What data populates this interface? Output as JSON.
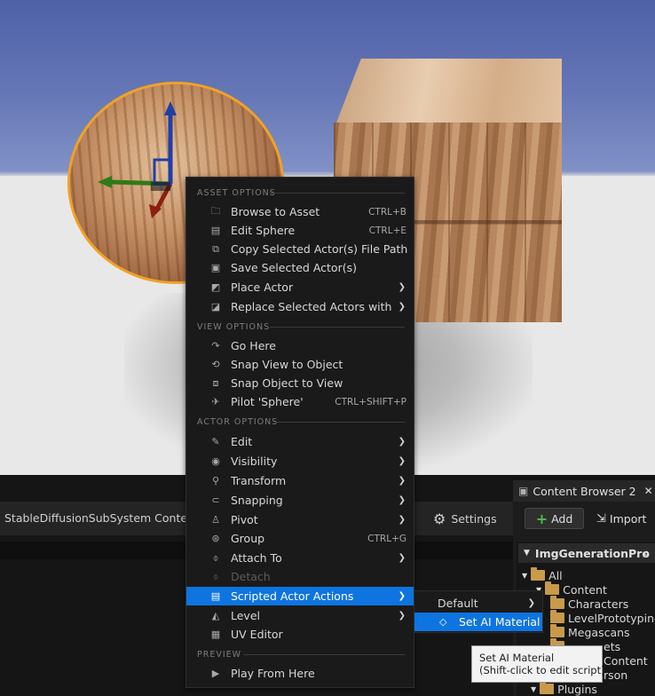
{
  "menu": {
    "sections": {
      "asset_options": "ASSET OPTIONS",
      "view_options": "VIEW OPTIONS",
      "actor_options": "ACTOR OPTIONS",
      "preview": "PREVIEW"
    },
    "items": {
      "browse_to_asset": {
        "label": "Browse to Asset",
        "shortcut": "CTRL+B"
      },
      "edit_sphere": {
        "label": "Edit Sphere",
        "shortcut": "CTRL+E"
      },
      "copy_path": {
        "label": "Copy Selected Actor(s) File Path"
      },
      "save_actors": {
        "label": "Save Selected Actor(s)"
      },
      "place_actor": {
        "label": "Place Actor"
      },
      "replace_actors": {
        "label": "Replace Selected Actors with"
      },
      "go_here": {
        "label": "Go Here"
      },
      "snap_view": {
        "label": "Snap View to Object"
      },
      "snap_object": {
        "label": "Snap Object to View"
      },
      "pilot": {
        "label": "Pilot 'Sphere'",
        "shortcut": "CTRL+SHIFT+P"
      },
      "edit": {
        "label": "Edit"
      },
      "visibility": {
        "label": "Visibility"
      },
      "transform": {
        "label": "Transform"
      },
      "snapping": {
        "label": "Snapping"
      },
      "pivot": {
        "label": "Pivot"
      },
      "group": {
        "label": "Group",
        "shortcut": "CTRL+G"
      },
      "attach_to": {
        "label": "Attach To"
      },
      "detach": {
        "label": "Detach"
      },
      "scripted_actions": {
        "label": "Scripted Actor Actions"
      },
      "level": {
        "label": "Level"
      },
      "uv_editor": {
        "label": "UV Editor"
      },
      "play_from_here": {
        "label": "Play From Here"
      }
    }
  },
  "submenu": {
    "default_label": "Default",
    "set_ai_material_label": "Set AI Material"
  },
  "tooltip": {
    "line1": "Set AI Material",
    "line2": "(Shift-click to edit script)"
  },
  "panels": {
    "sds_tab": "StableDiffusionSubSystem Content",
    "settings_label": "Settings"
  },
  "content_browser": {
    "tab_title": "Content Browser 2",
    "add_label": "Add",
    "import_label": "Import",
    "project_header": "ImgGenerationPro",
    "tree": {
      "all": "All",
      "content": "Content",
      "characters": "Characters",
      "levelprototyping": "LevelPrototyping",
      "megascans": "Megascans",
      "assets_partial": "ets",
      "content_partial": "Content",
      "person_partial": "rson",
      "plugins": "Plugins"
    }
  },
  "colors": {
    "selection": "#0e74e0",
    "menu_bg": "#1a1a1a",
    "outline": "#f0a226",
    "folder": "#c89a4a"
  }
}
